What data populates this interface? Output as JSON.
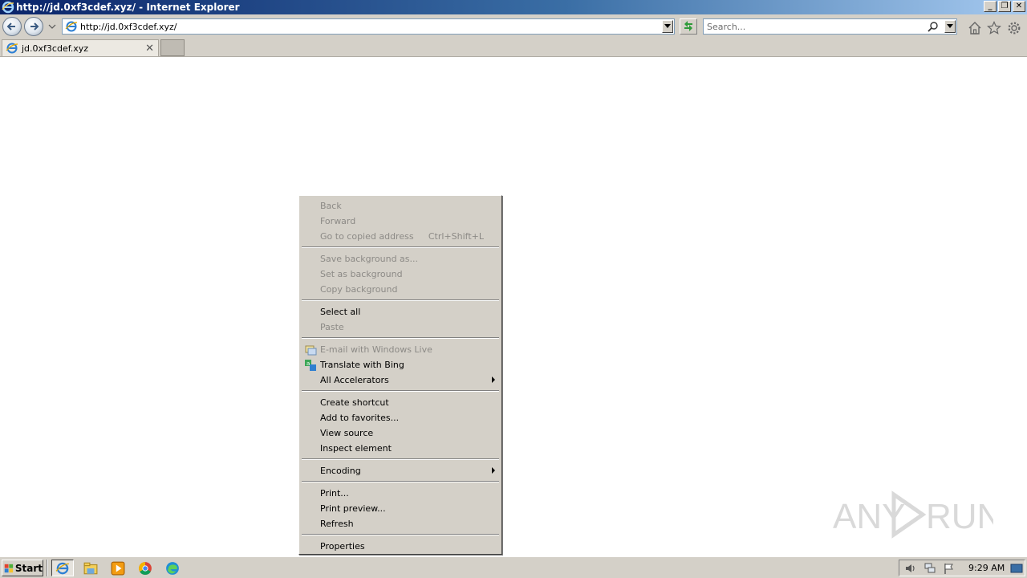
{
  "window": {
    "title": "http://jd.0xf3cdef.xyz/ - Internet Explorer",
    "controls": {
      "minimize": "_",
      "restore": "❐",
      "close": "✕"
    }
  },
  "navbar": {
    "address": "http://jd.0xf3cdef.xyz/",
    "search_placeholder": "Search..."
  },
  "tabs": [
    {
      "label": "jd.0xf3cdef.xyz"
    }
  ],
  "context_menu": {
    "items": [
      {
        "label": "Back",
        "disabled": true
      },
      {
        "label": "Forward",
        "disabled": true
      },
      {
        "label": "Go to copied address",
        "shortcut": "Ctrl+Shift+L",
        "disabled": true
      },
      {
        "label": "Save background as...",
        "disabled": true
      },
      {
        "label": "Set as background",
        "disabled": true
      },
      {
        "label": "Copy background",
        "disabled": true
      },
      {
        "label": "Select all",
        "disabled": false
      },
      {
        "label": "Paste",
        "disabled": true
      },
      {
        "label": "E-mail with Windows Live",
        "disabled": true,
        "icon": "windows-live-icon"
      },
      {
        "label": "Translate with Bing",
        "disabled": false,
        "icon": "bing-translate-icon"
      },
      {
        "label": "All Accelerators",
        "disabled": false,
        "submenu": true
      },
      {
        "label": "Create shortcut",
        "disabled": false
      },
      {
        "label": "Add to favorites...",
        "disabled": false
      },
      {
        "label": "View source",
        "disabled": false
      },
      {
        "label": "Inspect element",
        "disabled": false
      },
      {
        "label": "Encoding",
        "disabled": false,
        "submenu": true
      },
      {
        "label": "Print...",
        "disabled": false
      },
      {
        "label": "Print preview...",
        "disabled": false
      },
      {
        "label": "Refresh",
        "disabled": false
      },
      {
        "label": "Properties",
        "disabled": false
      }
    ]
  },
  "watermark": {
    "text": "ANY RUN"
  },
  "taskbar": {
    "start_label": "Start",
    "buttons": [
      "ie-icon",
      "explorer-icon",
      "media-player-icon",
      "chrome-icon",
      "edge-icon"
    ],
    "tray_icons": [
      "volume-icon",
      "network-icon",
      "action-center-flag-icon"
    ],
    "clock": "9:29 AM"
  },
  "colors": {
    "chrome": "#d4d0c8",
    "titlebar_start": "#0a246a",
    "disabled_text": "#8c8a86"
  }
}
